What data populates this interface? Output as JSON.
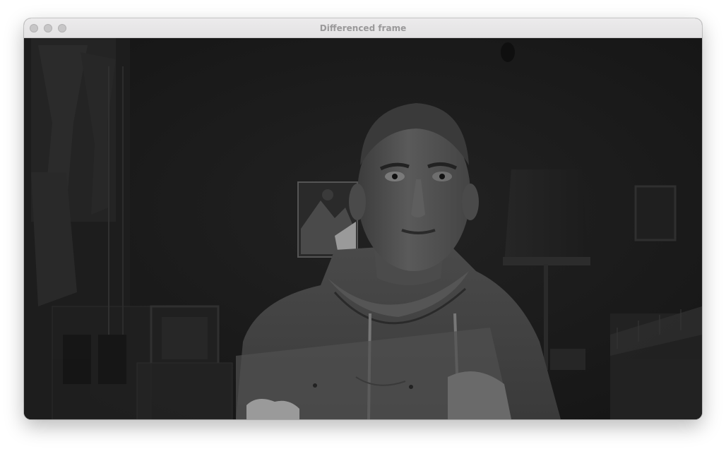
{
  "window": {
    "title": "Differenced frame",
    "controls": {
      "close": "close-button",
      "minimize": "minimize-button",
      "zoom": "zoom-button"
    }
  },
  "frame": {
    "description_icon": "video-frame",
    "colors": {
      "background": "#1b1b1b",
      "figure": "#5a5a5a",
      "highlight": "#9a9a9a"
    }
  }
}
